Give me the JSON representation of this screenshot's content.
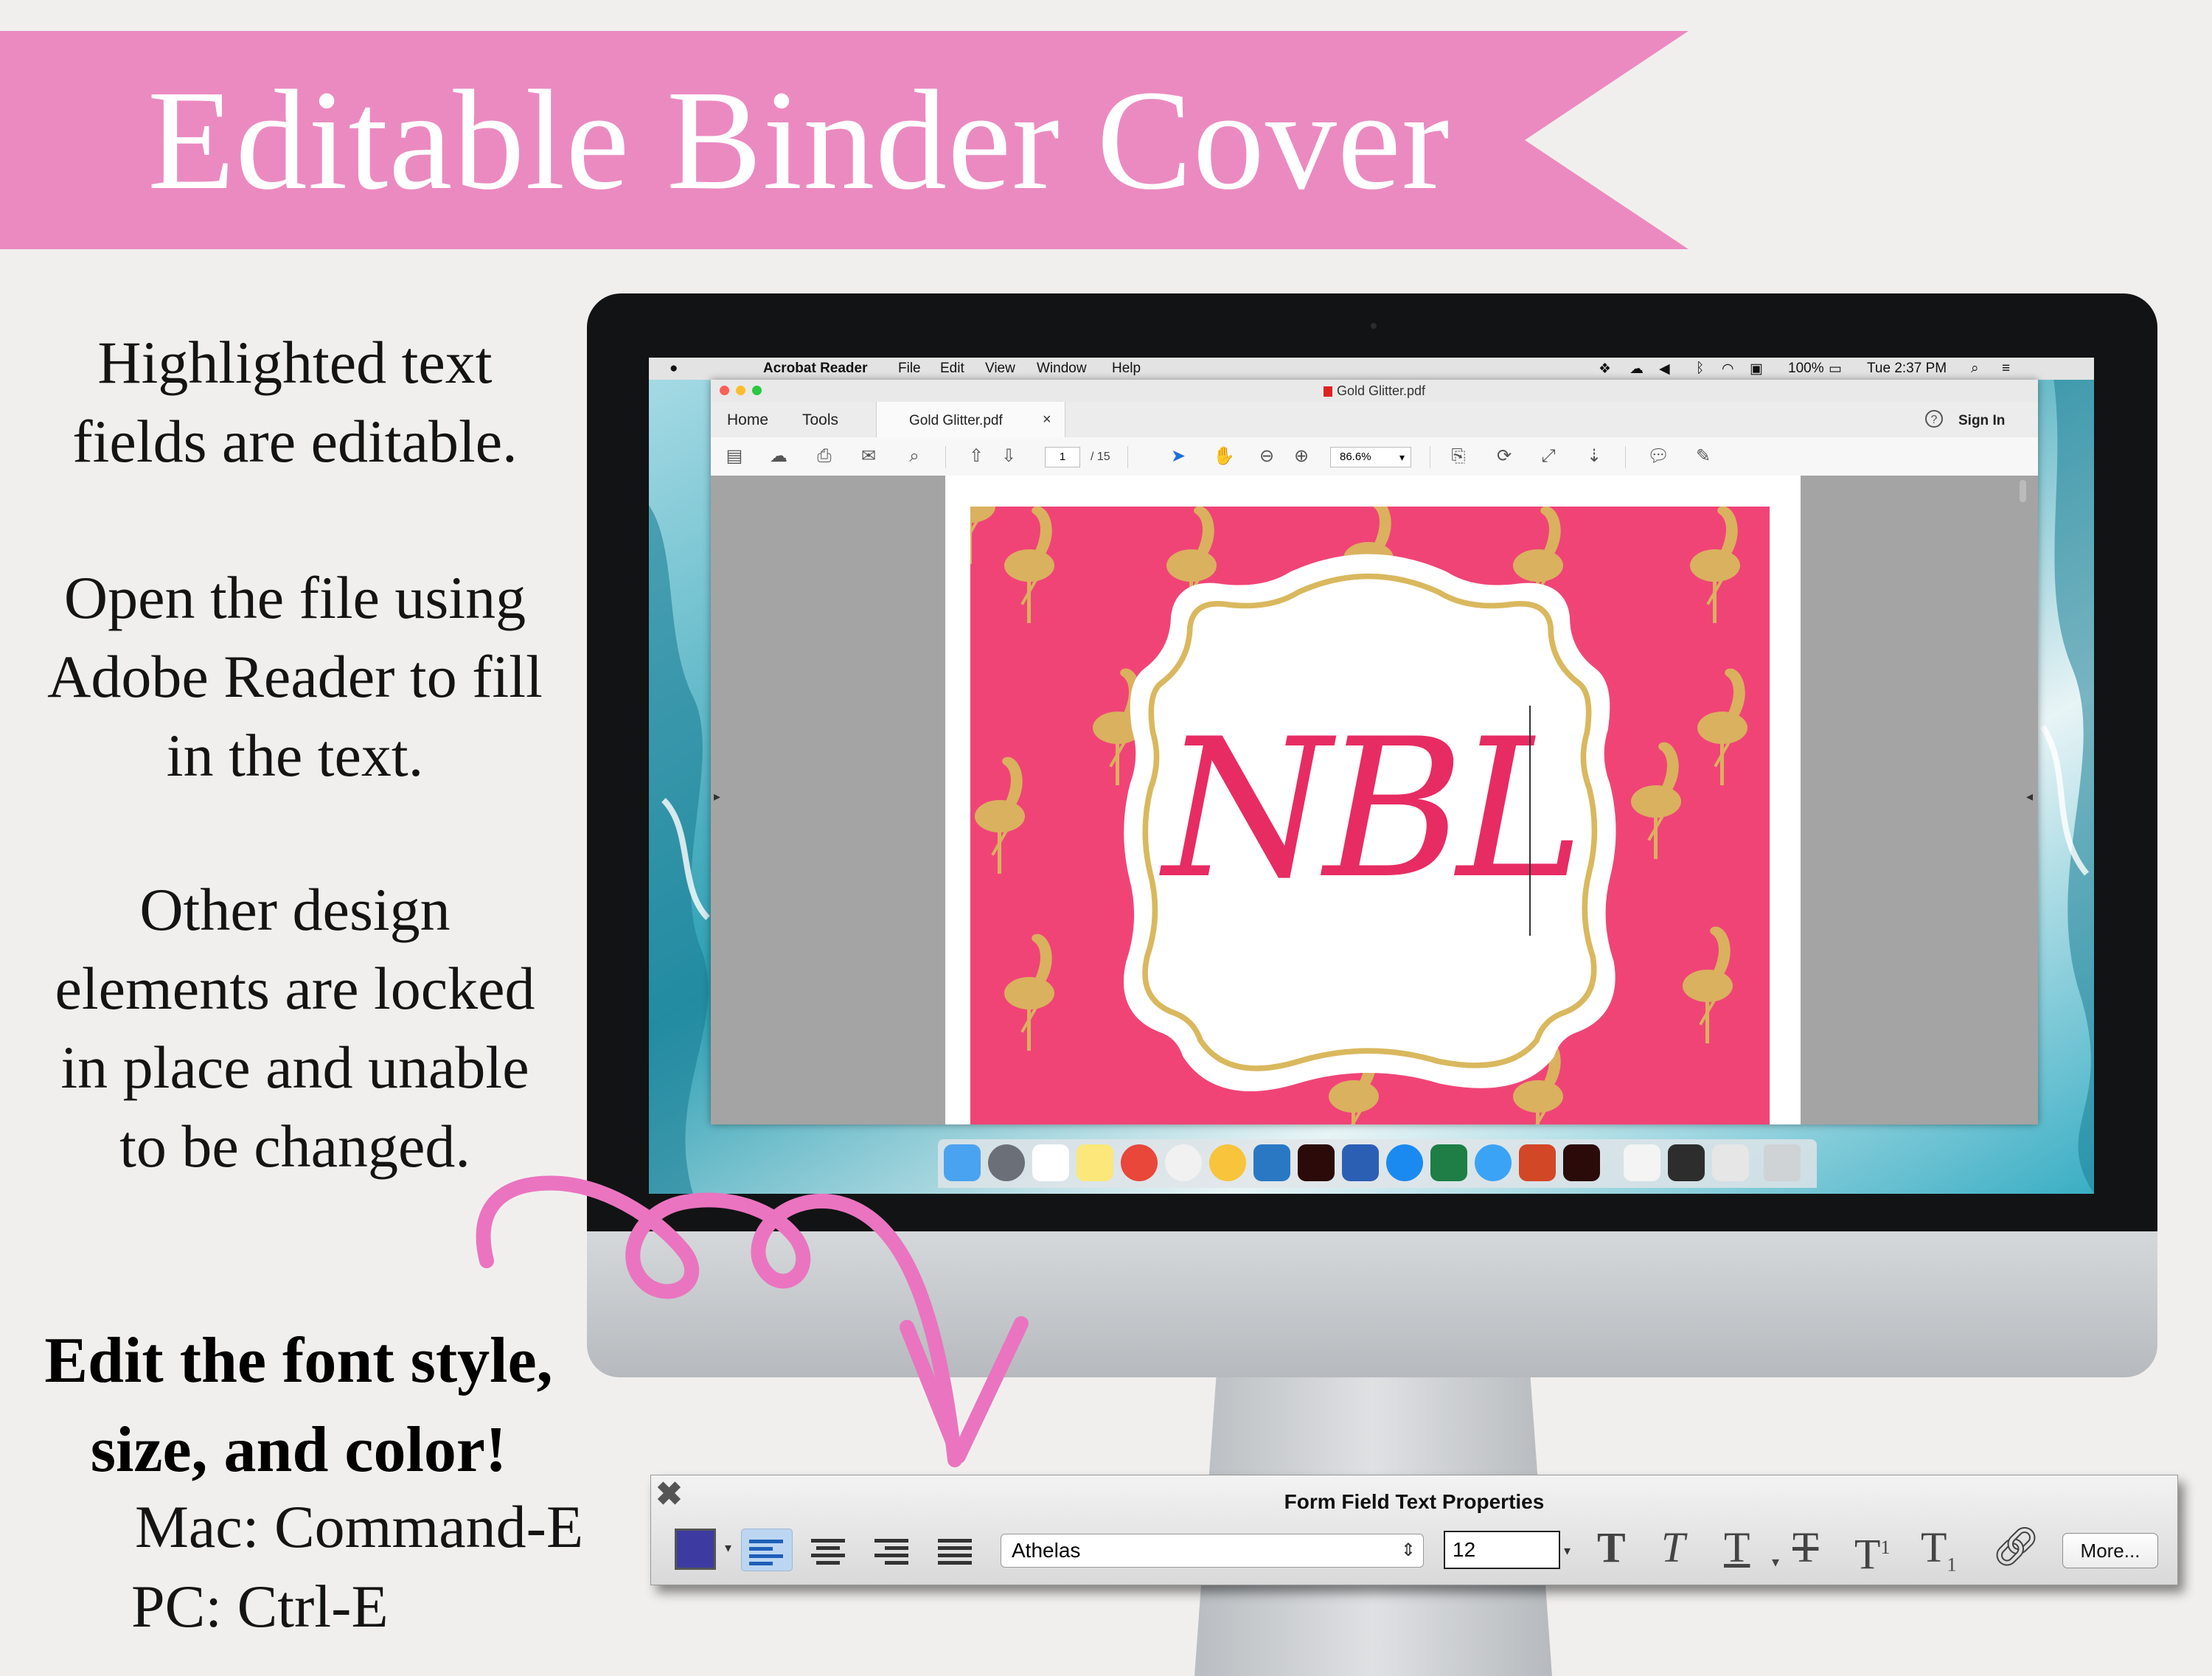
{
  "banner": {
    "title": "Editable Binder Cover",
    "color": "#eb8ac0"
  },
  "instructions": {
    "p1": [
      "Highlighted text",
      "fields are editable."
    ],
    "p2": [
      "Open the file using",
      "Adobe Reader to fill",
      "in the text."
    ],
    "p3": [
      "Other design",
      "elements are locked",
      "in place and unable",
      "to be changed."
    ],
    "edit_heading": [
      "Edit the font style,",
      "size, and color!"
    ],
    "mac_shortcut": "Mac: Command-E",
    "pc_shortcut": "PC: Ctrl-E"
  },
  "menubar": {
    "app": "Acrobat Reader",
    "items": [
      "File",
      "Edit",
      "View",
      "Window",
      "Help"
    ],
    "battery": "100%",
    "clock": "Tue 2:37 PM"
  },
  "window": {
    "file_title": "Gold Glitter.pdf"
  },
  "tabs": {
    "home": "Home",
    "tools": "Tools",
    "document": "Gold Glitter.pdf",
    "close": "×",
    "sign_in": "Sign In",
    "help": "?"
  },
  "toolbar": {
    "page_current": "1",
    "page_total": "/ 15",
    "zoom": "86.6%"
  },
  "cover": {
    "monogram": "NBL",
    "background_color": "#f04477",
    "glitter_color": "#d9b85e"
  },
  "props_panel": {
    "title": "Form Field Text Properties",
    "text_color": "#3d3ba1",
    "font": "Athelas",
    "size": "12",
    "more_label": "More..."
  }
}
